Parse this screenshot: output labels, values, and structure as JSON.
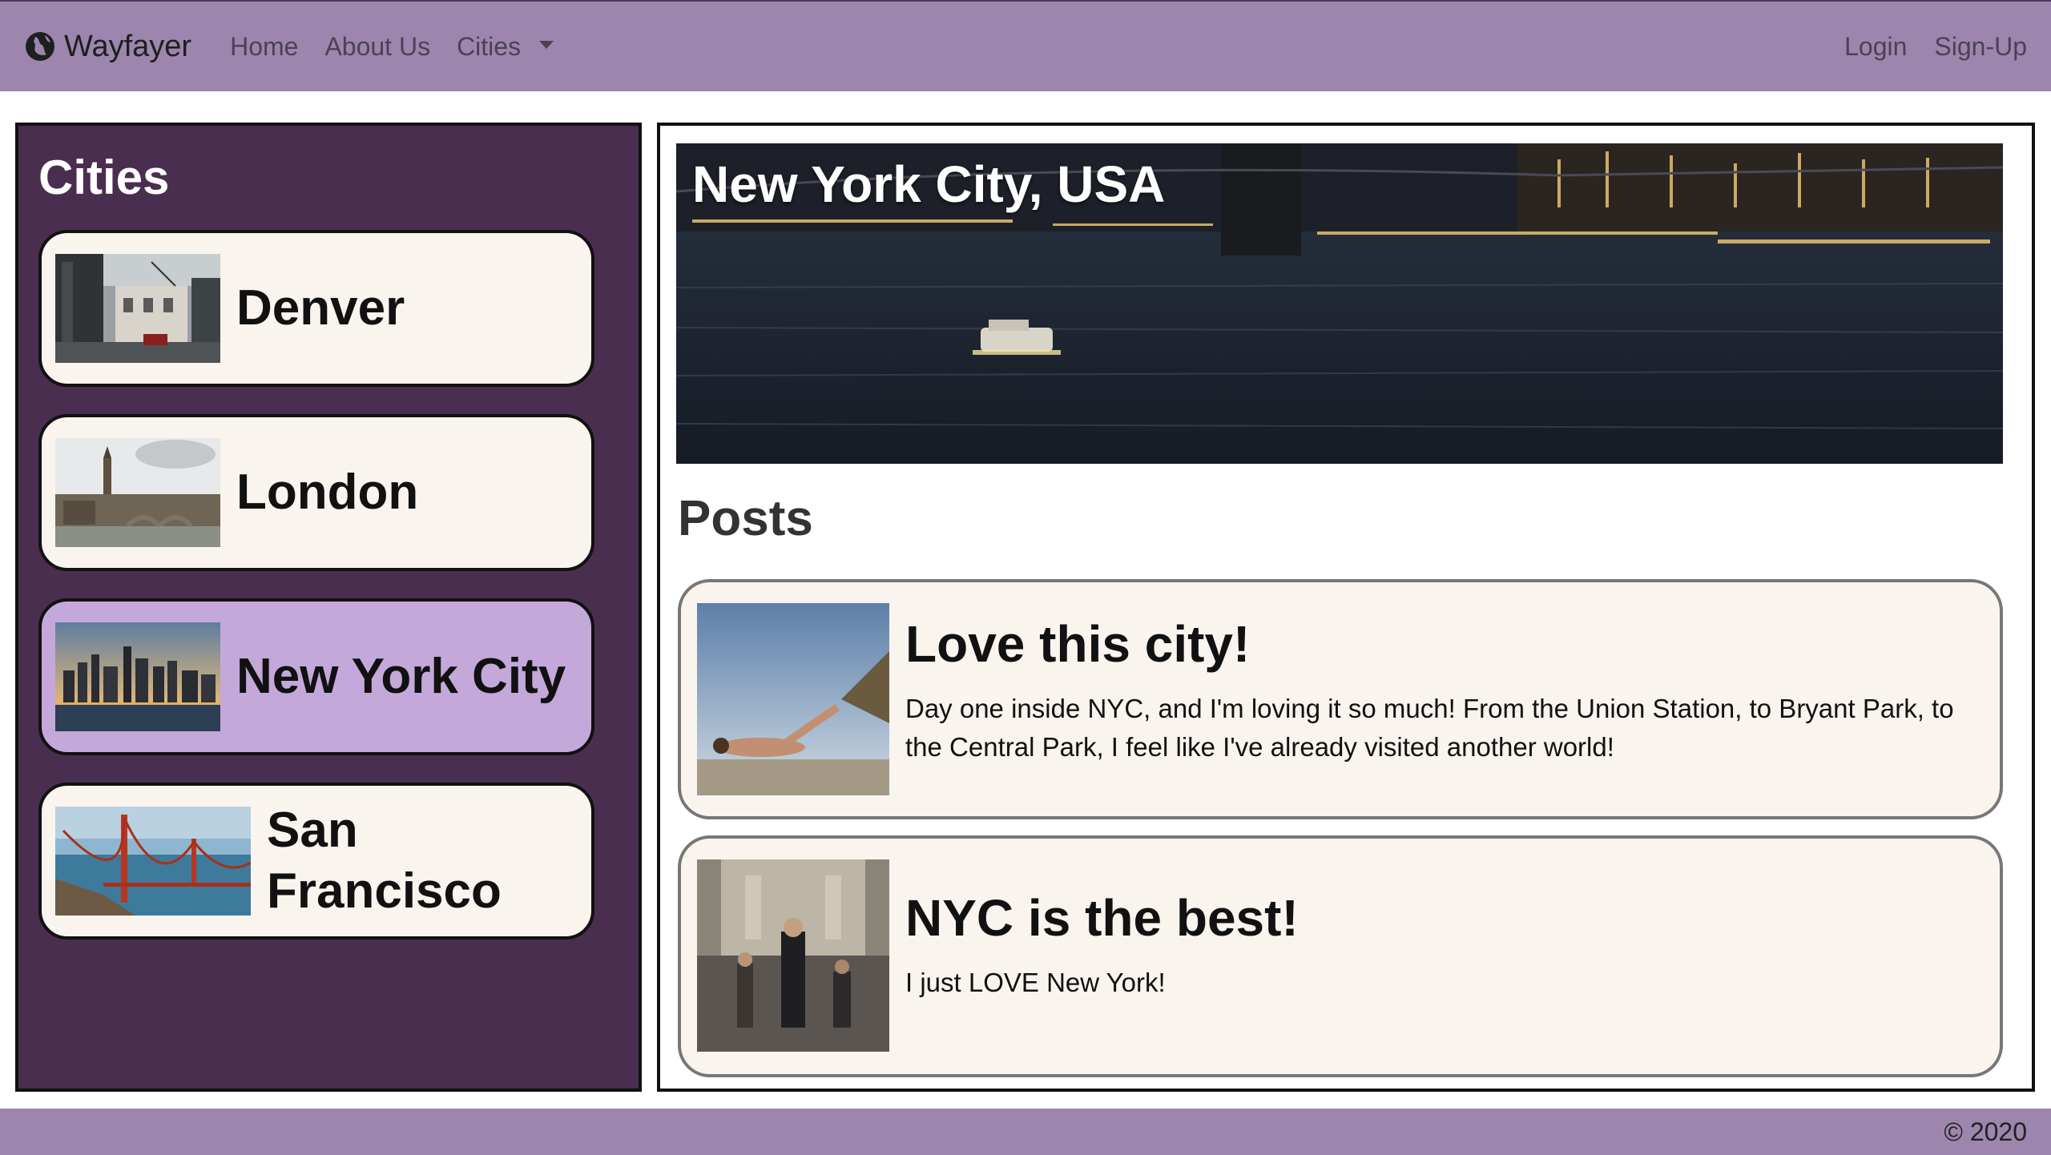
{
  "navbar": {
    "brand": "Wayfayer",
    "brand_icon": "globe-icon",
    "links": {
      "home": "Home",
      "about": "About Us",
      "cities": "Cities"
    },
    "right": {
      "login": "Login",
      "signup": "Sign-Up"
    }
  },
  "sidebar": {
    "title": "Cities",
    "items": [
      {
        "name": "Denver",
        "active": false
      },
      {
        "name": "London",
        "active": false
      },
      {
        "name": "New York City",
        "active": true
      },
      {
        "name": "San Francisco",
        "active": false
      }
    ]
  },
  "main": {
    "hero_title": "New York City, USA",
    "posts_heading": "Posts",
    "posts": [
      {
        "title": "Love this city!",
        "body": "Day one inside NYC, and I'm loving it so much! From the Union Station, to Bryant Park, to the Central Park, I feel like I've already visited another world!"
      },
      {
        "title": "NYC is the best!",
        "body": "I just LOVE New York!"
      }
    ]
  },
  "footer": {
    "copyright": "© 2020"
  },
  "colors": {
    "navbar": "#9c86ae",
    "sidebar": "#4a2e4f",
    "card": "#f9f4ee",
    "active_card": "#c4a8da"
  }
}
